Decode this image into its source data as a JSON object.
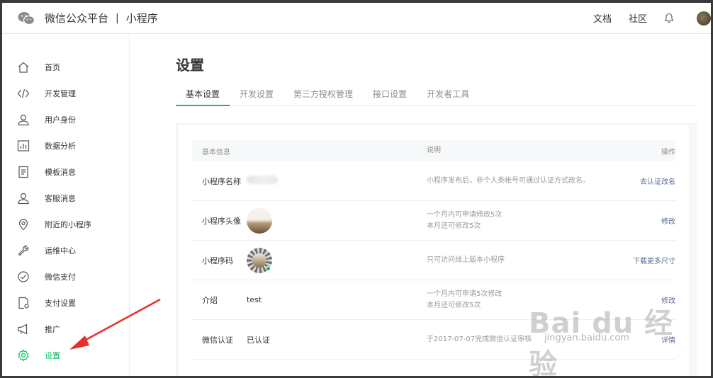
{
  "header": {
    "brand": "微信公众平台",
    "separator": "|",
    "product": "小程序",
    "links": [
      "文档",
      "社区"
    ]
  },
  "sidebar": {
    "items": [
      {
        "label": "首页",
        "icon": "home-icon"
      },
      {
        "label": "开发管理",
        "icon": "code-icon"
      },
      {
        "label": "用户身份",
        "icon": "user-icon"
      },
      {
        "label": "数据分析",
        "icon": "bar-chart-icon"
      },
      {
        "label": "模板消息",
        "icon": "document-icon"
      },
      {
        "label": "客服消息",
        "icon": "support-icon"
      },
      {
        "label": "附近的小程序",
        "icon": "location-icon"
      },
      {
        "label": "运维中心",
        "icon": "wrench-icon"
      },
      {
        "label": "微信支付",
        "icon": "payment-icon"
      },
      {
        "label": "支付设置",
        "icon": "payment-settings-icon"
      },
      {
        "label": "推广",
        "icon": "megaphone-icon"
      },
      {
        "label": "设置",
        "icon": "gear-icon",
        "active": true
      }
    ]
  },
  "main": {
    "title": "设置",
    "tabs": [
      {
        "label": "基本设置",
        "active": true
      },
      {
        "label": "开发设置"
      },
      {
        "label": "第三方授权管理"
      },
      {
        "label": "接口设置"
      },
      {
        "label": "开发者工具"
      }
    ],
    "table": {
      "headers": {
        "info": "基本信息",
        "desc": "说明",
        "action": "操作"
      },
      "rows": [
        {
          "label": "小程序名称",
          "value": "",
          "desc": [
            "小程序发布后，非个人类帐号可通过认证方式改名。"
          ],
          "action": "去认证改名"
        },
        {
          "label": "小程序头像",
          "value": "",
          "desc": [
            "一个月内可申请修改5次",
            "本月还可修改5次"
          ],
          "action": "修改"
        },
        {
          "label": "小程序码",
          "value": "",
          "desc": [
            "只可访问线上版本小程序"
          ],
          "action": "下载更多尺寸"
        },
        {
          "label": "介绍",
          "value": "test",
          "desc": [
            "一个月内可申请5次修改",
            "本月还可修改5次"
          ],
          "action": "修改"
        },
        {
          "label": "微信认证",
          "value": "已认证",
          "desc": [
            "于2017-07-07完成微信认证审核"
          ],
          "action": "详情"
        }
      ]
    }
  },
  "watermark": {
    "brand": "Bai du 经验",
    "url": "jingyan.baidu.com"
  },
  "colors": {
    "accent": "#07c160",
    "link": "#576b95",
    "muted": "#9a9a9a",
    "arrow": "#e8302a"
  }
}
